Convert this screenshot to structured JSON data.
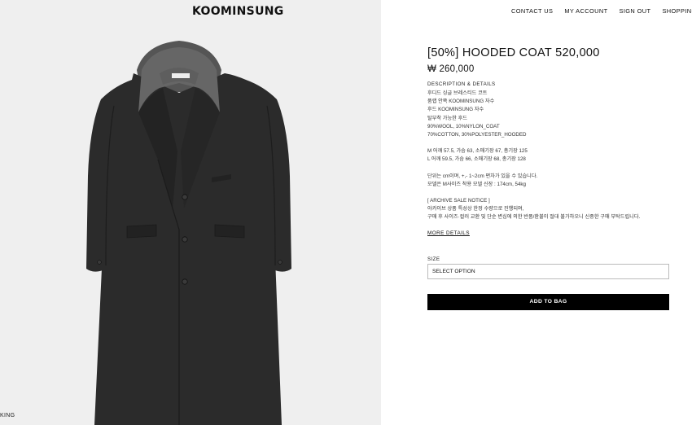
{
  "brand": {
    "logo": "KOOMINSUNG"
  },
  "nav": {
    "items": [
      "CONTACT US",
      "MY ACCOUNT",
      "SIGN OUT",
      "SHOPPING BAG"
    ]
  },
  "image_panel": {
    "bottom_text": "KING"
  },
  "product": {
    "title": "[50%] HOODED COAT 520,000",
    "price": "₩ 260,000",
    "description_heading": "DESCRIPTION & DETAILS",
    "details": [
      "후디드 싱글 브레스티드 코트",
      "품랩 안쪽 KOOMINSUNG 자수",
      "후드 KOOMINSUNG 자수",
      "탈부착 가능한 후드",
      "90%WOOL, 10%NYLON_COAT",
      "70%COTTON, 30%POLYESTER_HOODED"
    ],
    "sizes_info": [
      "M 어깨 57.5, 가슴 63, 소매기장 67, 총기장 125",
      "L 어깨 59.5, 가슴 66, 소매기장 68, 총기장 128"
    ],
    "notes": [
      "단위는 cm이며, +,- 1~2cm 편차가 있을 수 있습니다.",
      "모델은 M사이즈 착용 모델 신장 : 174cm, 54kg"
    ],
    "archive_notice": [
      "[ ARCHIVE SALE NOTICE ]",
      "아카이브 상품 특성상 한정 수량으로 진행되며,",
      "구매 후 사이즈·컬러 교환 및 단순 변심에 의한 반품/환불이 절대 불가하오니 신중한 구매 부탁드립니다."
    ],
    "more_details_label": "MORE DETAILS",
    "size_label": "SIZE",
    "select_value": "SELECT OPTION",
    "add_to_bag_label": "ADD TO BAG"
  },
  "colors": {
    "panel_bg": "#efefef",
    "coat": "#2a2a2a",
    "hood": "#5a5a5a",
    "button_bg": "#000000"
  }
}
